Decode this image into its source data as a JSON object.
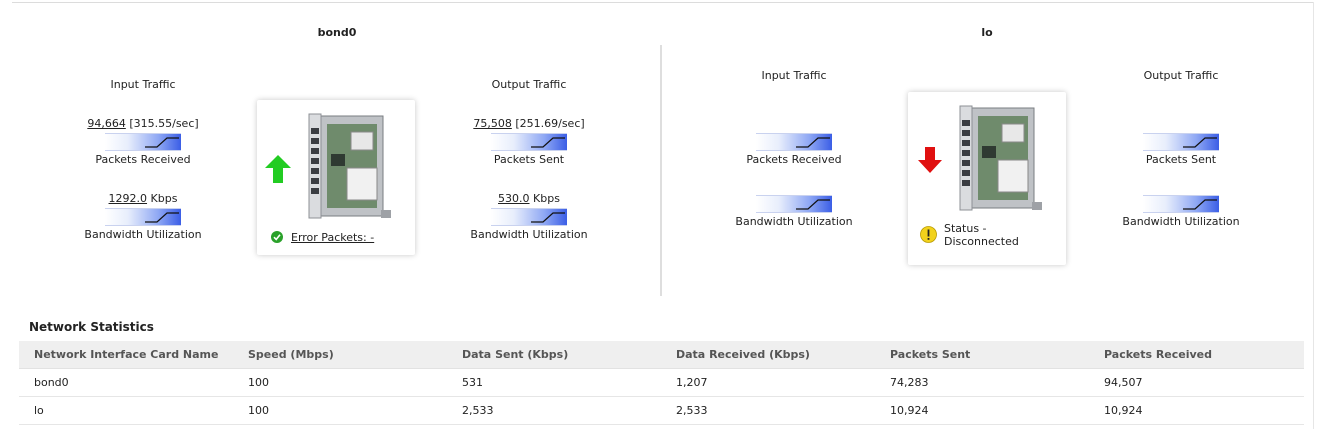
{
  "interfaces": {
    "bond0": {
      "title": "bond0",
      "input_heading": "Input Traffic",
      "output_heading": "Output Traffic",
      "packets_received_value": "94,664",
      "packets_received_rate": "[315.55/sec]",
      "packets_received_label": "Packets Received",
      "in_bandwidth_value": "1292.0",
      "in_bandwidth_unit": "Kbps",
      "in_bandwidth_label": "Bandwidth Utilization",
      "packets_sent_value": "75,508",
      "packets_sent_rate": "[251.69/sec]",
      "packets_sent_label": "Packets Sent",
      "out_bandwidth_value": "530.0",
      "out_bandwidth_unit": "Kbps",
      "out_bandwidth_label": "Bandwidth Utilization",
      "status_link": "Error Packets: -",
      "status_color": "#2aa12a",
      "arrow_color": "#22cc22"
    },
    "lo": {
      "title": "lo",
      "input_heading": "Input Traffic",
      "output_heading": "Output Traffic",
      "packets_received_label": "Packets Received",
      "in_bandwidth_label": "Bandwidth Utilization",
      "packets_sent_label": "Packets Sent",
      "out_bandwidth_label": "Bandwidth Utilization",
      "status_line1": "Status -",
      "status_line2": "Disconnected",
      "arrow_color": "#e01010",
      "warning_color": "#f2d21c"
    }
  },
  "statistics": {
    "title": "Network Statistics",
    "columns": [
      "Network Interface Card Name",
      "Speed (Mbps)",
      "Data Sent (Kbps)",
      "Data Received (Kbps)",
      "Packets Sent",
      "Packets Received"
    ],
    "rows": [
      [
        "bond0",
        "100",
        "531",
        "1,207",
        "74,283",
        "94,507"
      ],
      [
        "lo",
        "100",
        "2,533",
        "2,533",
        "10,924",
        "10,924"
      ]
    ]
  }
}
